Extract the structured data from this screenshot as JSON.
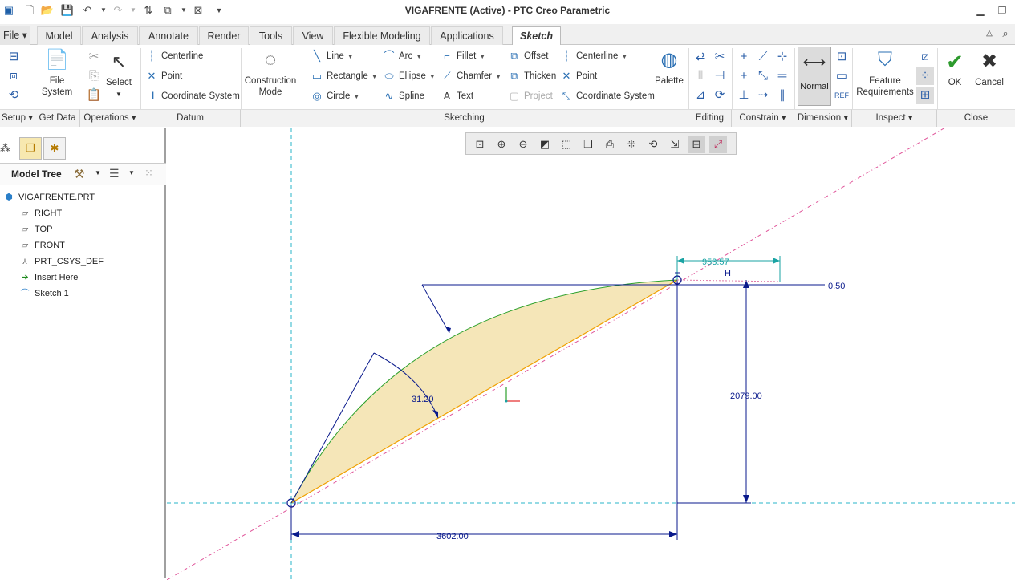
{
  "window": {
    "title": "VIGAFRENTE (Active) - PTC Creo Parametric"
  },
  "tabs": [
    {
      "label": "File",
      "name": "tab-file"
    },
    {
      "label": "Model",
      "name": "tab-model"
    },
    {
      "label": "Analysis",
      "name": "tab-analysis"
    },
    {
      "label": "Annotate",
      "name": "tab-annotate"
    },
    {
      "label": "Render",
      "name": "tab-render"
    },
    {
      "label": "Tools",
      "name": "tab-tools"
    },
    {
      "label": "View",
      "name": "tab-view"
    },
    {
      "label": "Flexible Modeling",
      "name": "tab-flexible-modeling"
    },
    {
      "label": "Applications",
      "name": "tab-applications"
    },
    {
      "label": "Sketch",
      "name": "tab-sketch"
    }
  ],
  "ribbon": {
    "file_system": "File\nSystem",
    "select": "Select",
    "datum": {
      "centerline": "Centerline",
      "point": "Point",
      "coordinate_system": "Coordinate System"
    },
    "construction_mode": "Construction\nMode",
    "sketching": {
      "line": "Line",
      "rectangle": "Rectangle",
      "circle": "Circle",
      "arc": "Arc",
      "ellipse": "Ellipse",
      "spline": "Spline",
      "fillet": "Fillet",
      "chamfer": "Chamfer",
      "text": "Text",
      "offset": "Offset",
      "thicken": "Thicken",
      "project": "Project",
      "centerline": "Centerline",
      "point": "Point",
      "coordinate_system": "Coordinate System"
    },
    "palette": "Palette",
    "normal": "Normal",
    "feature_requirements": "Feature\nRequirements",
    "ok": "OK",
    "cancel": "Cancel",
    "groups": {
      "setup": "Setup",
      "get_data": "Get Data",
      "operations": "Operations",
      "datum": "Datum",
      "sketching": "Sketching",
      "editing": "Editing",
      "constrain": "Constrain",
      "dimension": "Dimension",
      "inspect": "Inspect",
      "close": "Close"
    }
  },
  "model_tree": {
    "header": "Model Tree",
    "items": [
      {
        "label": "VIGAFRENTE.PRT",
        "icon": "part-icon"
      },
      {
        "label": "RIGHT",
        "icon": "datum-plane-icon"
      },
      {
        "label": "TOP",
        "icon": "datum-plane-icon"
      },
      {
        "label": "FRONT",
        "icon": "datum-plane-icon"
      },
      {
        "label": "PRT_CSYS_DEF",
        "icon": "csys-icon"
      },
      {
        "label": "Insert Here",
        "icon": "insert-arrow-icon"
      },
      {
        "label": "Sketch 1",
        "icon": "sketch-icon"
      }
    ]
  },
  "dimensions": {
    "angle": "31.20",
    "offset_h": "953.57",
    "h_label": "H",
    "small": "0.50",
    "height": "2079.00",
    "width": "3602.00"
  },
  "colors": {
    "fill": "#f5e6b8",
    "arc": "#2ca02c",
    "chord": "#f0a000",
    "dim": "#0a1a8c",
    "centerline": "#29b6c9",
    "construction": "#e0559a",
    "teal_dim": "#1aa3a3"
  }
}
